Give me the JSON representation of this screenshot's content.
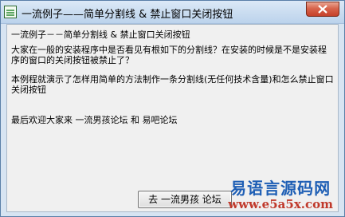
{
  "window": {
    "title": "一流例子——简单分割线 & 禁止窗口关闭按钮"
  },
  "content": {
    "heading": "一流例子－－简单分割线 & 禁止窗口关闭按钮",
    "paragraph1": "大家在一般的安装程序中是否看见有根如下的分割线？在安装的时候是不是安装程序的窗口的关闭按钮被禁止了？",
    "paragraph2": "本例程就演示了怎样用简单的方法制作一条分割线(无任何技术含量)和怎么禁止窗口关闭按钮",
    "closing": "最后欢迎大家来  一流男孩论坛  和  易吧论坛"
  },
  "buttons": {
    "go_label": "去  一流男孩 论坛"
  },
  "watermark": {
    "name": "易语言源码网",
    "url": "www.e5a5x.com"
  },
  "colors": {
    "close_button": "#c6412a",
    "watermark_name": "#1f5fb5",
    "watermark_url": "#c0392b"
  }
}
